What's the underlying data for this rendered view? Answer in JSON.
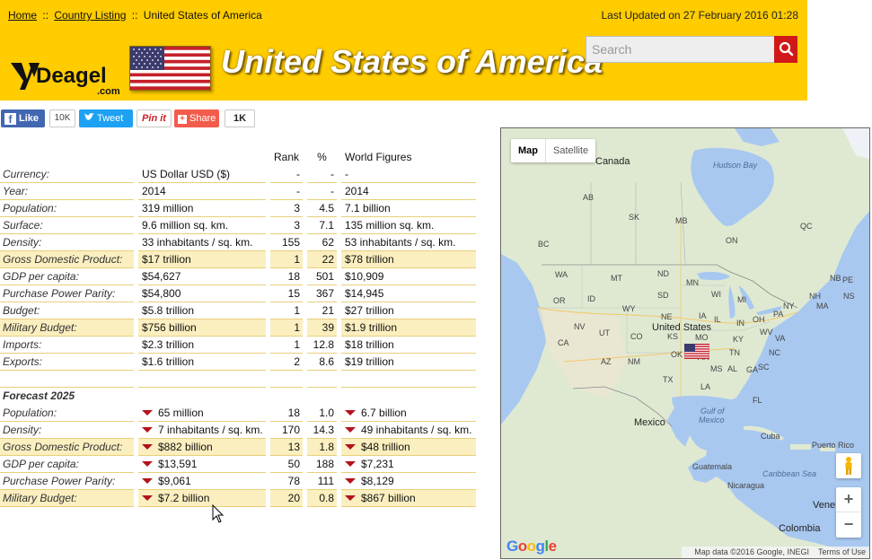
{
  "breadcrumb": {
    "home": "Home",
    "sep1": "::",
    "listing": "Country Listing",
    "sep2": "::",
    "current": "United States of America"
  },
  "last_updated": "Last Updated on 27 February 2016 01:28",
  "logo": {
    "text": "Deagel",
    "suffix": ".com"
  },
  "page_title": "United States of America",
  "search": {
    "placeholder": "Search"
  },
  "social": {
    "like_label": "Like",
    "like_count": "10K",
    "tweet_label": "Tweet",
    "pinit_label": "Pin it",
    "share_label": "Share",
    "share_count": "1K"
  },
  "colors": {
    "header_bg": "#ffcc00",
    "highlight_row": "#fbefc0",
    "row_border": "#e8cf7a",
    "search_button": "#d11818",
    "down_arrow": "#b3121c"
  },
  "table": {
    "headers": {
      "rank": "Rank",
      "pct": "%",
      "world": "World Figures"
    },
    "rows": [
      {
        "label": "Currency:",
        "value": "US Dollar USD ($)",
        "rank": "-",
        "pct": "-",
        "world": "-",
        "highlight": false
      },
      {
        "label": "Year:",
        "value": "2014",
        "rank": "-",
        "pct": "-",
        "world": "2014",
        "highlight": false
      },
      {
        "label": "Population:",
        "value": "319 million",
        "rank": "3",
        "pct": "4.5",
        "world": "7.1 billion",
        "highlight": false
      },
      {
        "label": "Surface:",
        "value": "9.6 million sq. km.",
        "rank": "3",
        "pct": "7.1",
        "world": "135 million sq. km.",
        "highlight": false
      },
      {
        "label": "Density:",
        "value": "33 inhabitants / sq. km.",
        "rank": "155",
        "pct": "62",
        "world": "53 inhabitants / sq. km.",
        "highlight": false
      },
      {
        "label": "Gross Domestic Product:",
        "value": "$17 trillion",
        "rank": "1",
        "pct": "22",
        "world": "$78 trillion",
        "highlight": true
      },
      {
        "label": "GDP per capita:",
        "value": "$54,627",
        "rank": "18",
        "pct": "501",
        "world": "$10,909",
        "highlight": false
      },
      {
        "label": "Purchase Power Parity:",
        "value": "$54,800",
        "rank": "15",
        "pct": "367",
        "world": "$14,945",
        "highlight": false
      },
      {
        "label": "Budget:",
        "value": "$5.8 trillion",
        "rank": "1",
        "pct": "21",
        "world": "$27 trillion",
        "highlight": false
      },
      {
        "label": "Military Budget:",
        "value": "$756 billion",
        "rank": "1",
        "pct": "39",
        "world": "$1.9 trillion",
        "highlight": true
      },
      {
        "label": "Imports:",
        "value": "$2.3 trillion",
        "rank": "1",
        "pct": "12.8",
        "world": "$18 trillion",
        "highlight": false
      },
      {
        "label": "Exports:",
        "value": "$1.6 trillion",
        "rank": "2",
        "pct": "8.6",
        "world": "$19 trillion",
        "highlight": false
      }
    ],
    "forecast_title": "Forecast 2025",
    "forecast_rows": [
      {
        "label": "Population:",
        "value": "65 million",
        "rank": "18",
        "pct": "1.0",
        "world": "6.7 billion",
        "highlight": false
      },
      {
        "label": "Density:",
        "value": "7 inhabitants / sq. km.",
        "rank": "170",
        "pct": "14.3",
        "world": "49 inhabitants / sq. km.",
        "highlight": false
      },
      {
        "label": "Gross Domestic Product:",
        "value": "$882 billion",
        "rank": "13",
        "pct": "1.8",
        "world": "$48 trillion",
        "highlight": true
      },
      {
        "label": "GDP per capita:",
        "value": "$13,591",
        "rank": "50",
        "pct": "188",
        "world": "$7,231",
        "highlight": false
      },
      {
        "label": "Purchase Power Parity:",
        "value": "$9,061",
        "rank": "78",
        "pct": "111",
        "world": "$8,129",
        "highlight": false
      },
      {
        "label": "Military Budget:",
        "value": "$7.2 billion",
        "rank": "20",
        "pct": "0.8",
        "world": "$867 billion",
        "highlight": true
      }
    ]
  },
  "map": {
    "tabs": {
      "map": "Map",
      "satellite": "Satellite"
    },
    "zoom_in": "+",
    "zoom_out": "−",
    "google": "Google",
    "attribution": "Map data ©2016 Google, INEGI",
    "terms": "Terms of Use",
    "labels": {
      "canada": "Canada",
      "hudson_bay": "Hudson Bay",
      "usa": "United States",
      "mexico": "Mexico",
      "gulf_of": "Gulf of",
      "gulf_mexico": "Mexico",
      "cuba": "Cuba",
      "puerto_rico": "Puerto Rico",
      "caribbean": "Caribbean Sea",
      "guatemala": "Guatemala",
      "nicaragua": "Nicaragua",
      "venezuela": "Vene",
      "colombia": "Colombia",
      "ab": "AB",
      "sk": "SK",
      "mb": "MB",
      "on": "ON",
      "qc": "QC",
      "bc": "BC",
      "nb": "NB",
      "ns": "NS",
      "pe": "PE",
      "wa": "WA",
      "mt": "MT",
      "nd": "ND",
      "mn": "MN",
      "or": "OR",
      "id": "ID",
      "sd": "SD",
      "wi": "WI",
      "mi": "MI",
      "nh": "NH",
      "ny": "NY",
      "ma": "MA",
      "wy": "WY",
      "ia": "IA",
      "nv": "NV",
      "ne": "NE",
      "il": "IL",
      "in": "IN",
      "oh": "OH",
      "pa": "PA",
      "ut": "UT",
      "co": "CO",
      "ks": "KS",
      "mo": "MO",
      "wv": "WV",
      "ca": "CA",
      "ok": "OK",
      "ky": "KY",
      "va": "VA",
      "az": "AZ",
      "nm": "NM",
      "ar": "AR",
      "tn": "TN",
      "nc": "NC",
      "ms": "MS",
      "al": "AL",
      "ga": "GA",
      "sc": "SC",
      "tx": "TX",
      "la": "LA",
      "fl": "FL"
    }
  }
}
